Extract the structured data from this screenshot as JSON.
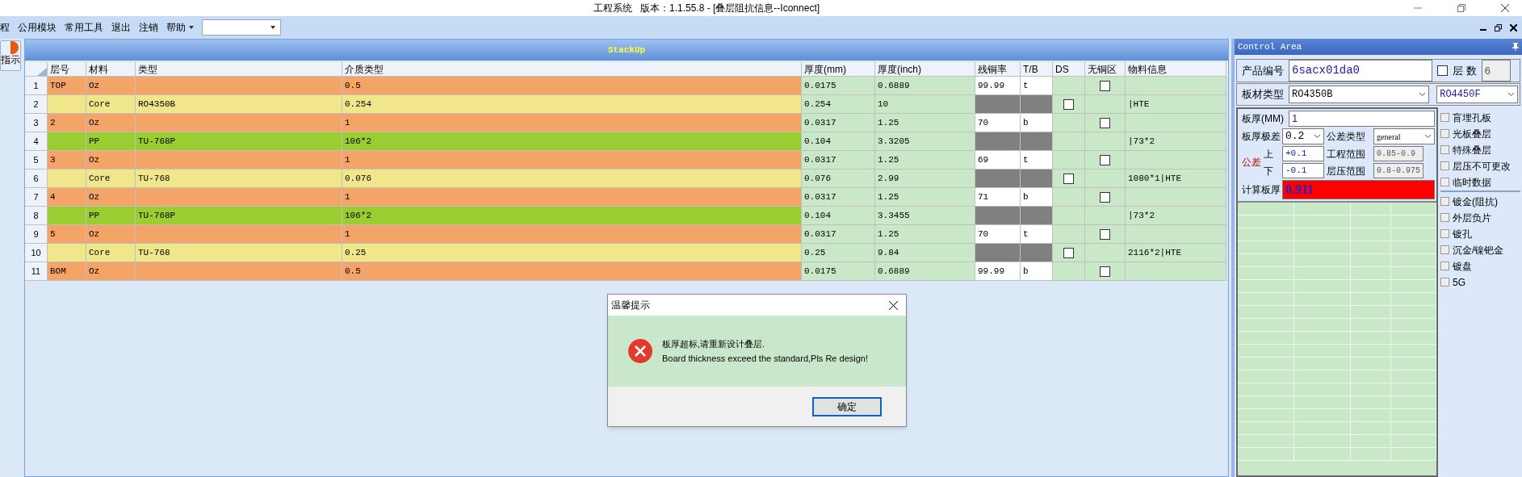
{
  "window": {
    "title": "工程系统   版本：1.1.55.8 - [叠层阻抗信息--Iconnect]"
  },
  "menu": {
    "items": [
      {
        "label": "程",
        "kind": "item"
      },
      {
        "label": "公用模块",
        "kind": "item"
      },
      {
        "label": "常用工具",
        "kind": "item"
      },
      {
        "label": "退出",
        "kind": "item"
      },
      {
        "label": "注销",
        "kind": "item"
      },
      {
        "label": "帮助",
        "kind": "dropdown"
      }
    ]
  },
  "left_strip": {
    "button": "指示"
  },
  "stackup": {
    "title": "StackUp",
    "columns": [
      "层号",
      "材料",
      "类型",
      "介质类型",
      "厚度(mm)",
      "厚度(inch)",
      "残铜率",
      "T/B",
      "DS",
      "无铜区",
      "物料信息"
    ],
    "rows": [
      {
        "num": "1",
        "kind": "copper",
        "layer": "TOP",
        "material": "Oz",
        "type": "",
        "dielectric": "0.5",
        "mm": "0.0175",
        "inch": "0.6889",
        "copper": "99.99",
        "tb": "t",
        "no_copper_zone": {
          "checked": false
        },
        "info": ""
      },
      {
        "num": "2",
        "kind": "core",
        "layer": "",
        "material": "Core",
        "type": "RO4350B",
        "dielectric": "0.254",
        "mm": "0.254",
        "inch": "10",
        "ds": {
          "checked": false
        },
        "info": "|HTE"
      },
      {
        "num": "3",
        "kind": "copper",
        "layer": "2",
        "material": "Oz",
        "type": "",
        "dielectric": "1",
        "mm": "0.0317",
        "inch": "1.25",
        "copper": "70",
        "tb": "b",
        "no_copper_zone": {
          "checked": false
        },
        "info": ""
      },
      {
        "num": "4",
        "kind": "prepreg",
        "layer": "",
        "material": "PP",
        "type": "TU-768P",
        "dielectric": "106*2",
        "mm": "0.104",
        "inch": "3.3205",
        "info": "|73*2"
      },
      {
        "num": "5",
        "kind": "copper",
        "layer": "3",
        "material": "Oz",
        "type": "",
        "dielectric": "1",
        "mm": "0.0317",
        "inch": "1.25",
        "copper": "69",
        "tb": "t",
        "no_copper_zone": {
          "checked": false
        },
        "info": ""
      },
      {
        "num": "6",
        "kind": "core",
        "layer": "",
        "material": "Core",
        "type": "TU-768",
        "dielectric": "0.076",
        "mm": "0.076",
        "inch": "2.99",
        "ds": {
          "checked": false
        },
        "info": "1080*1|HTE"
      },
      {
        "num": "7",
        "kind": "copper",
        "layer": "4",
        "material": "Oz",
        "type": "",
        "dielectric": "1",
        "mm": "0.0317",
        "inch": "1.25",
        "copper": "71",
        "tb": "b",
        "no_copper_zone": {
          "checked": false
        },
        "info": ""
      },
      {
        "num": "8",
        "kind": "prepreg",
        "layer": "",
        "material": "PP",
        "type": "TU-768P",
        "dielectric": "106*2",
        "mm": "0.104",
        "inch": "3.3455",
        "info": "|73*2"
      },
      {
        "num": "9",
        "kind": "copper",
        "layer": "5",
        "material": "Oz",
        "type": "",
        "dielectric": "1",
        "mm": "0.0317",
        "inch": "1.25",
        "copper": "70",
        "tb": "t",
        "no_copper_zone": {
          "checked": false
        },
        "info": ""
      },
      {
        "num": "10",
        "kind": "core",
        "layer": "",
        "material": "Core",
        "type": "TU-768",
        "dielectric": "0.25",
        "mm": "0.25",
        "inch": "9.84",
        "ds": {
          "checked": false
        },
        "info": "2116*2|HTE"
      },
      {
        "num": "11",
        "kind": "copper",
        "layer": "BOM",
        "material": "Oz",
        "type": "",
        "dielectric": "0.5",
        "mm": "0.0175",
        "inch": "0.6889",
        "copper": "99.99",
        "tb": "b",
        "no_copper_zone": {
          "checked": false
        },
        "info": ""
      }
    ]
  },
  "control_area": {
    "title": "Control Area",
    "product_no": {
      "label": "产品编号",
      "value": "6sacx01da0"
    },
    "layer_count": {
      "label": "层 数",
      "checked": false,
      "value": "6"
    },
    "board_material": {
      "label": "板材类型",
      "value": "RO4350B",
      "value2": "RO4450F"
    },
    "thickness": {
      "label": "板厚(MM)",
      "value": "1"
    },
    "tolerance": {
      "label": "板厚极差",
      "value": "0.2"
    },
    "tolerance_type": {
      "label": "公差类型",
      "value": "general"
    },
    "tolerance_label": "公差",
    "upper": {
      "label": "上",
      "value": "+0.1"
    },
    "lower": {
      "label": "下",
      "value": "-0.1"
    },
    "eng_range": {
      "label": "工程范围",
      "value": "0.85-0.9"
    },
    "press_range": {
      "label": "层压范围",
      "value": "0.8-0.975"
    },
    "calc": {
      "label": "计算板厚",
      "value": "0.911",
      "alert": true
    },
    "option_groups": [
      [
        {
          "label": "盲埋孔板",
          "checked": false
        },
        {
          "label": "光板叠层",
          "checked": false
        },
        {
          "label": "特殊叠层",
          "checked": false
        },
        {
          "label": "层压不可更改",
          "checked": false
        },
        {
          "label": "临时数据",
          "checked": false
        }
      ],
      [
        {
          "label": "镀金(阻抗)",
          "checked": false
        },
        {
          "label": "外层负片",
          "checked": false
        },
        {
          "label": "镀孔",
          "checked": false
        },
        {
          "label": "沉金/镍钯金",
          "checked": false
        },
        {
          "label": "镀盘",
          "checked": false
        },
        {
          "label": "5G",
          "checked": false
        }
      ]
    ]
  },
  "dialog": {
    "title": "温馨提示",
    "message_cn": "板厚超标,请重新设计叠层.",
    "message_en": "Board thickness exceed the standard,Pls Re design!",
    "ok": "确定"
  }
}
